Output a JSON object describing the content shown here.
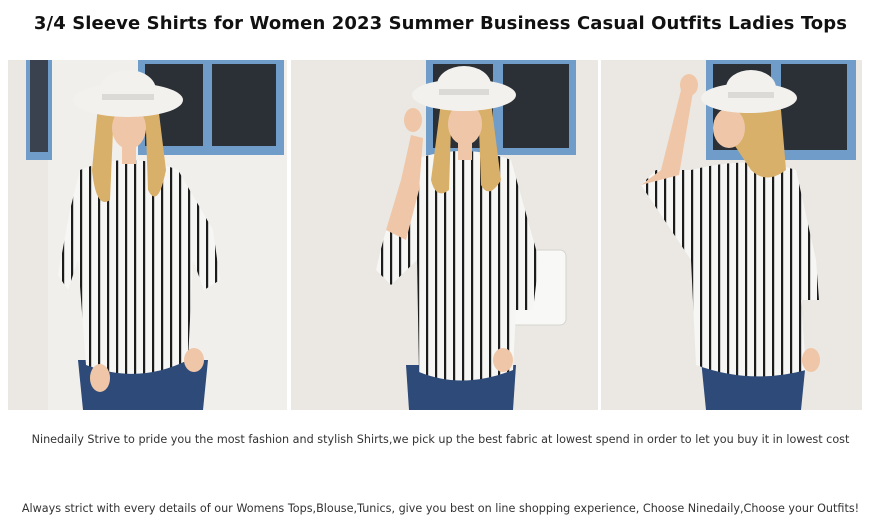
{
  "header": {
    "title": "3/4 Sleeve Shirts for Women 2023 Summer Business Casual Outfits Ladies Tops"
  },
  "gallery": {
    "photos": [
      {
        "alt": "model-front-view"
      },
      {
        "alt": "model-front-hand-on-hat"
      },
      {
        "alt": "model-back-view"
      }
    ]
  },
  "description": {
    "line1": "Ninedaily Strive to pride you the most fashion and stylish Shirts,we pick up the best fabric at lowest spend in order to let you buy it in lowest cost",
    "line2": "Always strict with every details of our Womens Tops,Blouse,Tunics, give you best on line shopping experience, Choose Ninedaily,Choose your Outfits!"
  },
  "colors": {
    "wall": "#ebe8e3",
    "window_frame": "#6f9cc9",
    "stripe_dark": "#1c1c1c",
    "shirt_white": "#f6f6f4",
    "jeans": "#2e4a78",
    "hair": "#d9b06a",
    "hat": "#f2f1ee",
    "skin": "#efc7a8"
  }
}
